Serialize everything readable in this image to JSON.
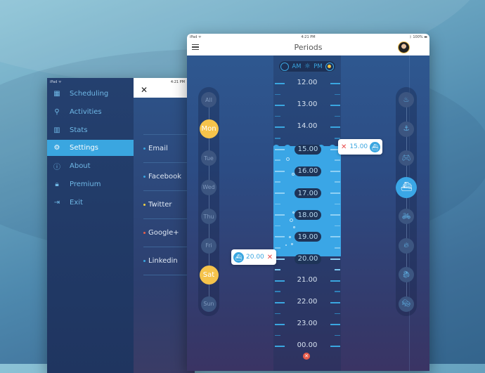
{
  "left_tablet": {
    "status": {
      "carrier": "iPad ᯤ",
      "time": "4:21 PM"
    },
    "menu": [
      {
        "label": "Scheduling",
        "icon": "calendar-icon",
        "glyph": "▦",
        "active": false
      },
      {
        "label": "Activities",
        "icon": "activities-icon",
        "glyph": "⚲",
        "active": false
      },
      {
        "label": "Stats",
        "icon": "stats-icon",
        "glyph": "▥",
        "active": false
      },
      {
        "label": "Settings",
        "icon": "gear-icon",
        "glyph": "⚙",
        "active": true
      },
      {
        "label": "About",
        "icon": "info-icon",
        "glyph": "ⓘ",
        "active": false
      },
      {
        "label": "Premium",
        "icon": "lock-icon",
        "glyph": "🔒︎",
        "active": false
      },
      {
        "label": "Exit",
        "icon": "exit-icon",
        "glyph": "⇥",
        "active": false
      }
    ],
    "close_glyph": "✕",
    "social": [
      {
        "label": "Email",
        "color": "#3aa6e0"
      },
      {
        "label": "Facebook",
        "color": "#3aa6e0"
      },
      {
        "label": "Twitter",
        "color": "#f5d442"
      },
      {
        "label": "Google+",
        "color": "#e8604a"
      },
      {
        "label": "Linkedin",
        "color": "#3aa6e0"
      }
    ]
  },
  "right_tablet": {
    "status": {
      "carrier": "iPad ᯤ",
      "time": "4:21 PM",
      "battery": "100%"
    },
    "title": "Periods",
    "toggle": {
      "am": "AM",
      "pm": "PM",
      "selected": "PM"
    },
    "hours": [
      "12.00",
      "13.00",
      "14.00",
      "15.00",
      "16.00",
      "17.00",
      "18.00",
      "19.00",
      "20.00",
      "21.00",
      "22.00",
      "23.00",
      "00.00"
    ],
    "range": {
      "start": "15.00",
      "end": "20.00"
    },
    "start_callout": {
      "time": "15.00",
      "remove": "✕"
    },
    "end_callout": {
      "time": "20.00",
      "remove": "✕"
    },
    "days": [
      {
        "label": "All",
        "selected": false
      },
      {
        "label": "Mon",
        "selected": true
      },
      {
        "label": "Tue",
        "selected": false
      },
      {
        "label": "Wed",
        "selected": false
      },
      {
        "label": "Thu",
        "selected": false
      },
      {
        "label": "Fri",
        "selected": false
      },
      {
        "label": "Sat",
        "selected": true
      },
      {
        "label": "Sun",
        "selected": false
      }
    ],
    "activities": [
      {
        "icon": "cooking-pot-icon",
        "glyph": "♨",
        "selected": false
      },
      {
        "icon": "anchor-icon",
        "glyph": "⚓",
        "selected": false
      },
      {
        "icon": "gamepad-icon",
        "glyph": "🎮︎",
        "selected": false
      },
      {
        "icon": "ship-icon",
        "glyph": "⛴",
        "selected": true
      },
      {
        "icon": "bicycle-icon",
        "glyph": "🚲︎",
        "selected": false
      },
      {
        "icon": "fire-icon",
        "glyph": "🔥︎",
        "selected": false
      },
      {
        "icon": "dragon-icon",
        "glyph": "🐉︎",
        "selected": false
      },
      {
        "icon": "mask-icon",
        "glyph": "🎭︎",
        "selected": false
      }
    ],
    "clear_glyph": "✕"
  }
}
